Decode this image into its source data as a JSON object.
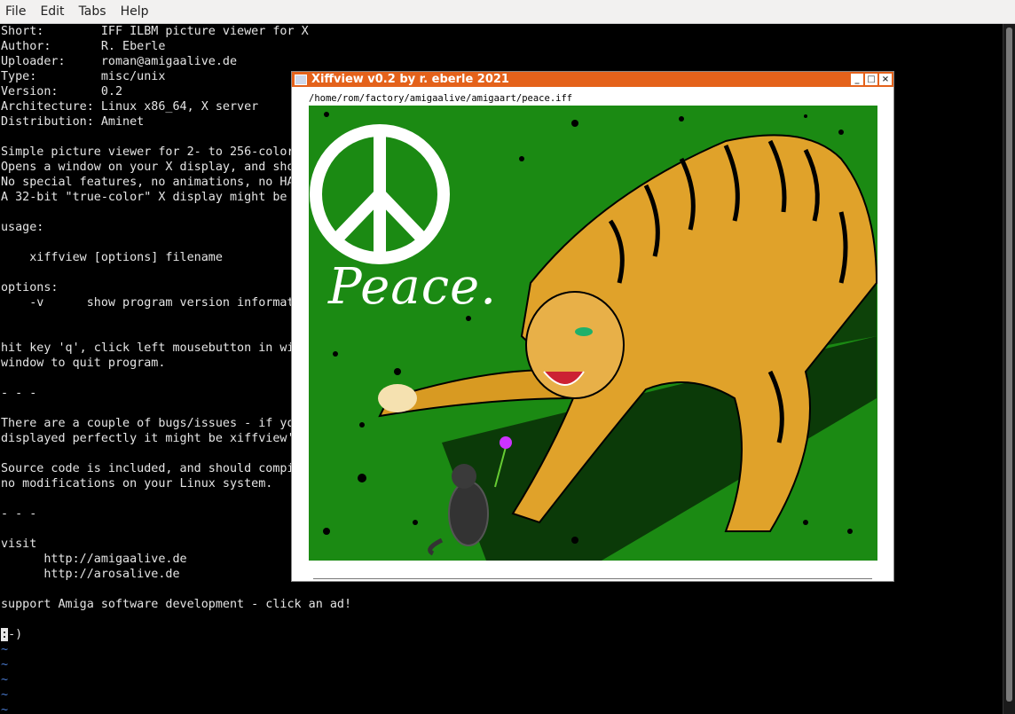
{
  "menu": {
    "items": [
      "File",
      "Edit",
      "Tabs",
      "Help"
    ]
  },
  "terminal": {
    "lines": [
      "Short:        IFF ILBM picture viewer for X",
      "Author:       R. Eberle",
      "Uploader:     roman@amigaalive.de",
      "Type:         misc/unix",
      "Version:      0.2",
      "Architecture: Linux x86_64, X server",
      "Distribution: Aminet",
      "",
      "Simple picture viewer for 2- to 256-color",
      "Opens a window on your X display, and sho",
      "No special features, no animations, no HA",
      "A 32-bit \"true-color\" X display might be ",
      "",
      "usage:",
      "",
      "    xiffview [options] filename",
      "",
      "options:",
      "    -v      show program version informat",
      "",
      "",
      "hit key 'q', click left mousebutton in wi",
      "window to quit program.",
      "",
      "- - -",
      "",
      "There are a couple of bugs/issues - if yo",
      "displayed perfectly it might be xiffview'",
      "",
      "Source code is included, and should compi",
      "no modifications on your Linux system.",
      "",
      "- - -",
      "",
      "visit",
      "      http://amigaalive.de",
      "      http://arosalive.de",
      "",
      "support Amiga software development - click an ad!",
      ""
    ],
    "cursor_line": {
      "cursor": ":",
      "rest": "-)"
    },
    "tilde_lines": [
      "~",
      "~",
      "~",
      "~",
      "~"
    ]
  },
  "xiffview": {
    "title": "Xiffview v0.2 by r. eberle 2021",
    "path": "/home/rom/factory/amigaalive/amigaart/peace.iff",
    "image_text": "Peace.",
    "buttons": {
      "minimize": "_",
      "maximize": "□",
      "close": "×"
    }
  },
  "colors": {
    "terminal_bg": "#000000",
    "terminal_fg": "#e5e5e5",
    "tilde": "#4a7bd0",
    "titlebar": "#e4621b",
    "image_green": "#1b8a13",
    "tiger_orange": "#e0a22a"
  }
}
